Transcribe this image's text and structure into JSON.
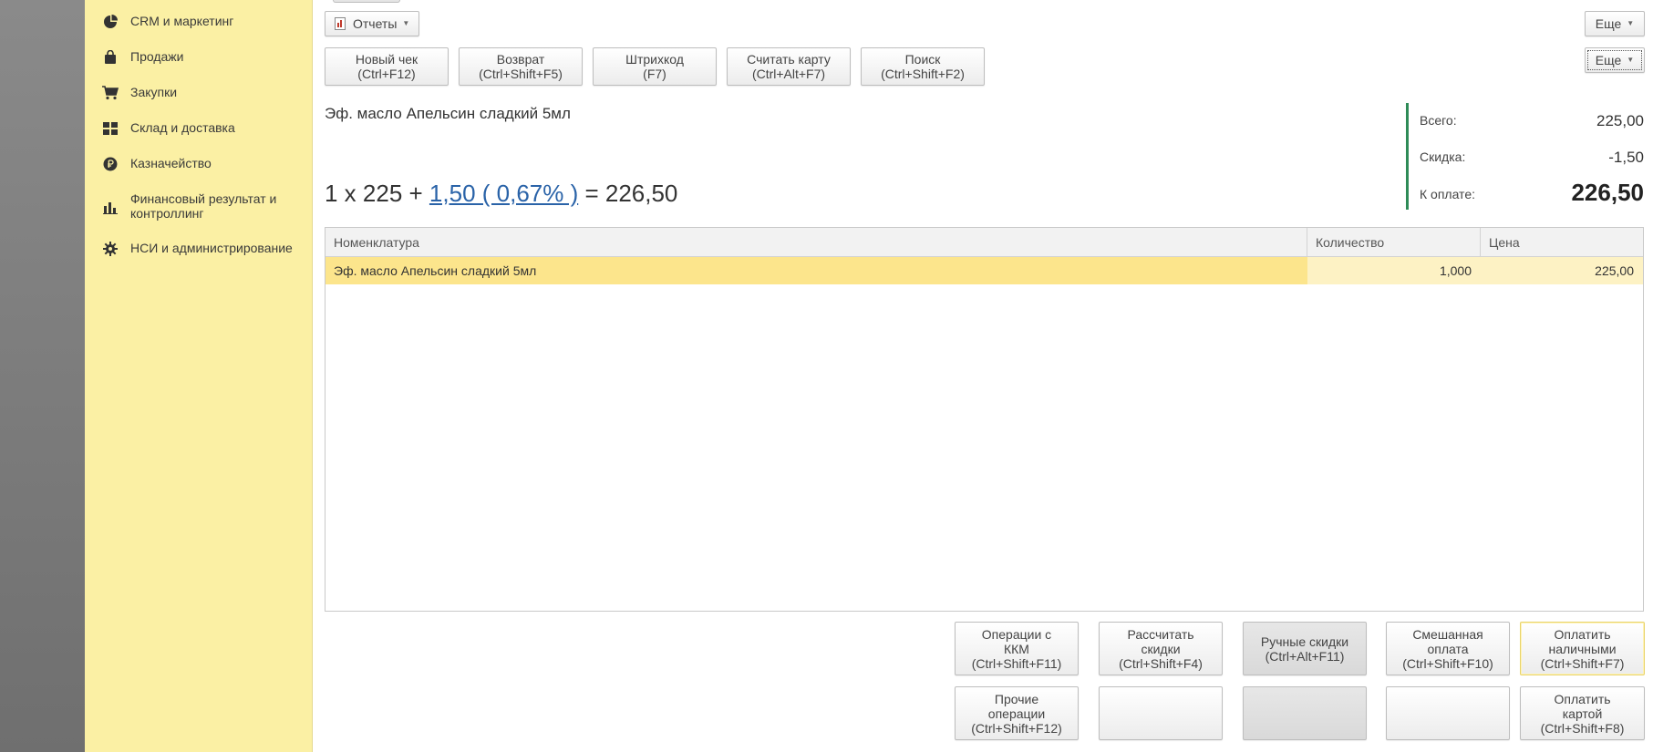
{
  "sidebar": {
    "items": [
      {
        "label": "CRM и маркетинг",
        "icon": "pie-chart-icon"
      },
      {
        "label": "Продажи",
        "icon": "shopping-bag-icon"
      },
      {
        "label": "Закупки",
        "icon": "cart-icon"
      },
      {
        "label": "Склад и доставка",
        "icon": "warehouse-grid-icon"
      },
      {
        "label": "Казначейство",
        "icon": "ruble-coin-icon"
      },
      {
        "label": "Финансовый результат и контроллинг",
        "icon": "bar-chart-icon"
      },
      {
        "label": "НСИ и администрирование",
        "icon": "gear-icon"
      }
    ]
  },
  "toolbar": {
    "reports_label": "Отчеты",
    "more_label": "Еще",
    "more2_label": "Еще"
  },
  "actions": {
    "new_check": {
      "line1": "Новый чек",
      "line2": "(Ctrl+F12)"
    },
    "return": {
      "line1": "Возврат",
      "line2": "(Ctrl+Shift+F5)"
    },
    "barcode": {
      "line1": "Штрихкод",
      "line2": "(F7)"
    },
    "read_card": {
      "line1": "Считать карту",
      "line2": "(Ctrl+Alt+F7)"
    },
    "search": {
      "line1": "Поиск",
      "line2": "(Ctrl+Shift+F2)"
    }
  },
  "current_item": {
    "title": "Эф. масло Апельсин сладкий 5мл",
    "formula_prefix": "1 х 225 + ",
    "formula_discount": "1,50 ( 0,67% )",
    "formula_suffix": " = 226,50"
  },
  "totals": {
    "total_label": "Всего:",
    "total_value": "225,00",
    "discount_label": "Скидка:",
    "discount_value": "-1,50",
    "pay_label": "К оплате:",
    "pay_value": "226,50",
    "accent_color": "#2e8b57"
  },
  "grid": {
    "columns": [
      "Номенклатура",
      "Количество",
      "Цена"
    ],
    "rows": [
      {
        "name": "Эф. масло Апельсин сладкий 5мл",
        "qty": "1,000",
        "price": "225,00"
      }
    ],
    "selected_row_color": "#fce58c"
  },
  "bottom": {
    "kkm_ops": {
      "line1": "Операции с",
      "line2": "ККМ",
      "line3": "(Ctrl+Shift+F11)"
    },
    "calc_discounts": {
      "line1": "Рассчитать",
      "line2": "скидки",
      "line3": "(Ctrl+Shift+F4)"
    },
    "manual_discounts": {
      "line1": "Ручные скидки",
      "line2": "(Ctrl+Alt+F11)"
    },
    "mixed_payment": {
      "line1": "Смешанная",
      "line2": "оплата",
      "line3": "(Ctrl+Shift+F10)"
    },
    "pay_cash": {
      "line1": "Оплатить",
      "line2": "наличными",
      "line3": "(Ctrl+Shift+F7)"
    },
    "other_ops": {
      "line1": "Прочие",
      "line2": "операции",
      "line3": "(Ctrl+Shift+F12)"
    },
    "pay_card": {
      "line1": "Оплатить",
      "line2": "картой",
      "line3": "(Ctrl+Shift+F8)"
    }
  }
}
